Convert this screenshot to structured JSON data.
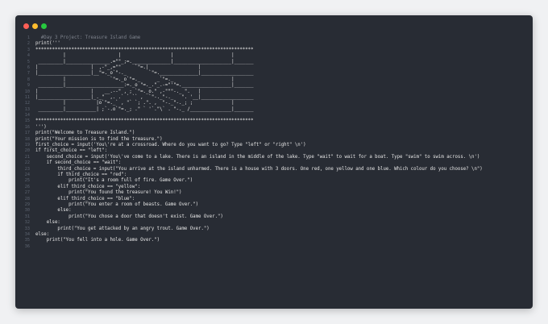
{
  "window": {
    "buttons": [
      "close",
      "minimize",
      "maximize"
    ],
    "colors": {
      "background": "#282c34",
      "close": "#ff5f56",
      "minimize": "#ffbd2e",
      "maximize": "#27c93f"
    }
  },
  "code": {
    "lines": [
      {
        "n": "1",
        "text": "  #Day 3 Project: Treasure Island Game",
        "kind": "comment"
      },
      {
        "n": "2",
        "text": "print('''",
        "kind": "code"
      },
      {
        "n": "3",
        "text": "*******************************************************************************",
        "kind": "code"
      },
      {
        "n": "4",
        "text": "          |                   |                  |                     |",
        "kind": "code"
      },
      {
        "n": "5",
        "text": " _________|________________.=\"\"_;=.______________|_____________________|_______",
        "kind": "code"
      },
      {
        "n": "6",
        "text": "|                   |  ,-\"_,=\"\"     `\"=.|                  |",
        "kind": "code"
      },
      {
        "n": "7",
        "text": "|___________________|__\"=._o`\"-._        `\"=.______________|___________________",
        "kind": "code"
      },
      {
        "n": "8",
        "text": "          |                `\"=._o`\"=._      _`\"=._                     |",
        "kind": "code"
      },
      {
        "n": "9",
        "text": " _________|_____________________:=._o \"=._.\"_.-=\"'\"=.__________________|_______",
        "kind": "code"
      },
      {
        "n": "10",
        "text": "|                   |    __.--\" , ; `\"=._o.\" ,-\"\"\"-._ \".   |",
        "kind": "code"
      },
      {
        "n": "11",
        "text": "|___________________|_._\"  ,. .` ` `` ,  `\"-._\"-._   \". '__|___________________",
        "kind": "code"
      },
      {
        "n": "12",
        "text": "          |           |o`\"=._` , \"` `; .\". ,  \"-._\"-._; ;              |",
        "kind": "code"
      },
      {
        "n": "13",
        "text": " _________|___________| ;`-.o`\"=._; .\" ` '`.\"\\` . \"-._ /_______________|_______",
        "kind": "code"
      },
      {
        "n": "14",
        "text": "",
        "kind": "code"
      },
      {
        "n": "15",
        "text": "*******************************************************************************",
        "kind": "code"
      },
      {
        "n": "16",
        "text": "''')",
        "kind": "code"
      },
      {
        "n": "17",
        "text": "print(\"Welcome to Treasure Island.\")",
        "kind": "code"
      },
      {
        "n": "18",
        "text": "print(\"Your mission is to find the treasure.\")",
        "kind": "code"
      },
      {
        "n": "19",
        "text": "first_choice = input('You\\'re at a crossroad. Where do you want to go? Type \"left\" or \"right\" \\n')",
        "kind": "code"
      },
      {
        "n": "20",
        "text": "if first_choice == \"left\":",
        "kind": "code"
      },
      {
        "n": "21",
        "text": "    second_choice = input('You\\'ve come to a lake. There is an island in the middle of the lake. Type \"wait\" to wait for a boat. Type \"swim\" to swim across. \\n')",
        "kind": "code"
      },
      {
        "n": "22",
        "text": "    if second_choice == \"wait\":",
        "kind": "code"
      },
      {
        "n": "23",
        "text": "        third_choice = input(\"You arrive at the island unharmed. There is a house with 3 doors. One red, one yellow and one blue. Which colour do you choose? \\n\")",
        "kind": "code"
      },
      {
        "n": "24",
        "text": "        if third_choice == \"red\":",
        "kind": "code"
      },
      {
        "n": "25",
        "text": "            print(\"It's a room full of fire. Game Over.\")",
        "kind": "code"
      },
      {
        "n": "26",
        "text": "        elif third_choice == \"yellow\":",
        "kind": "code"
      },
      {
        "n": "27",
        "text": "            print(\"You found the treasure! You Win!\")",
        "kind": "code"
      },
      {
        "n": "28",
        "text": "        elif third_choice == \"blue\":",
        "kind": "code"
      },
      {
        "n": "29",
        "text": "            print(\"You enter a room of beasts. Game Over.\")",
        "kind": "code"
      },
      {
        "n": "30",
        "text": "        else:",
        "kind": "code"
      },
      {
        "n": "31",
        "text": "            print(\"You chose a door that doesn't exist. Game Over.\")",
        "kind": "code"
      },
      {
        "n": "32",
        "text": "    else:",
        "kind": "code"
      },
      {
        "n": "33",
        "text": "        print(\"You get attacked by an angry trout. Game Over.\")",
        "kind": "code"
      },
      {
        "n": "34",
        "text": "else:",
        "kind": "code"
      },
      {
        "n": "35",
        "text": "    print(\"You fell into a hole. Game Over.\")",
        "kind": "code"
      },
      {
        "n": "36",
        "text": "",
        "kind": "code"
      }
    ]
  }
}
